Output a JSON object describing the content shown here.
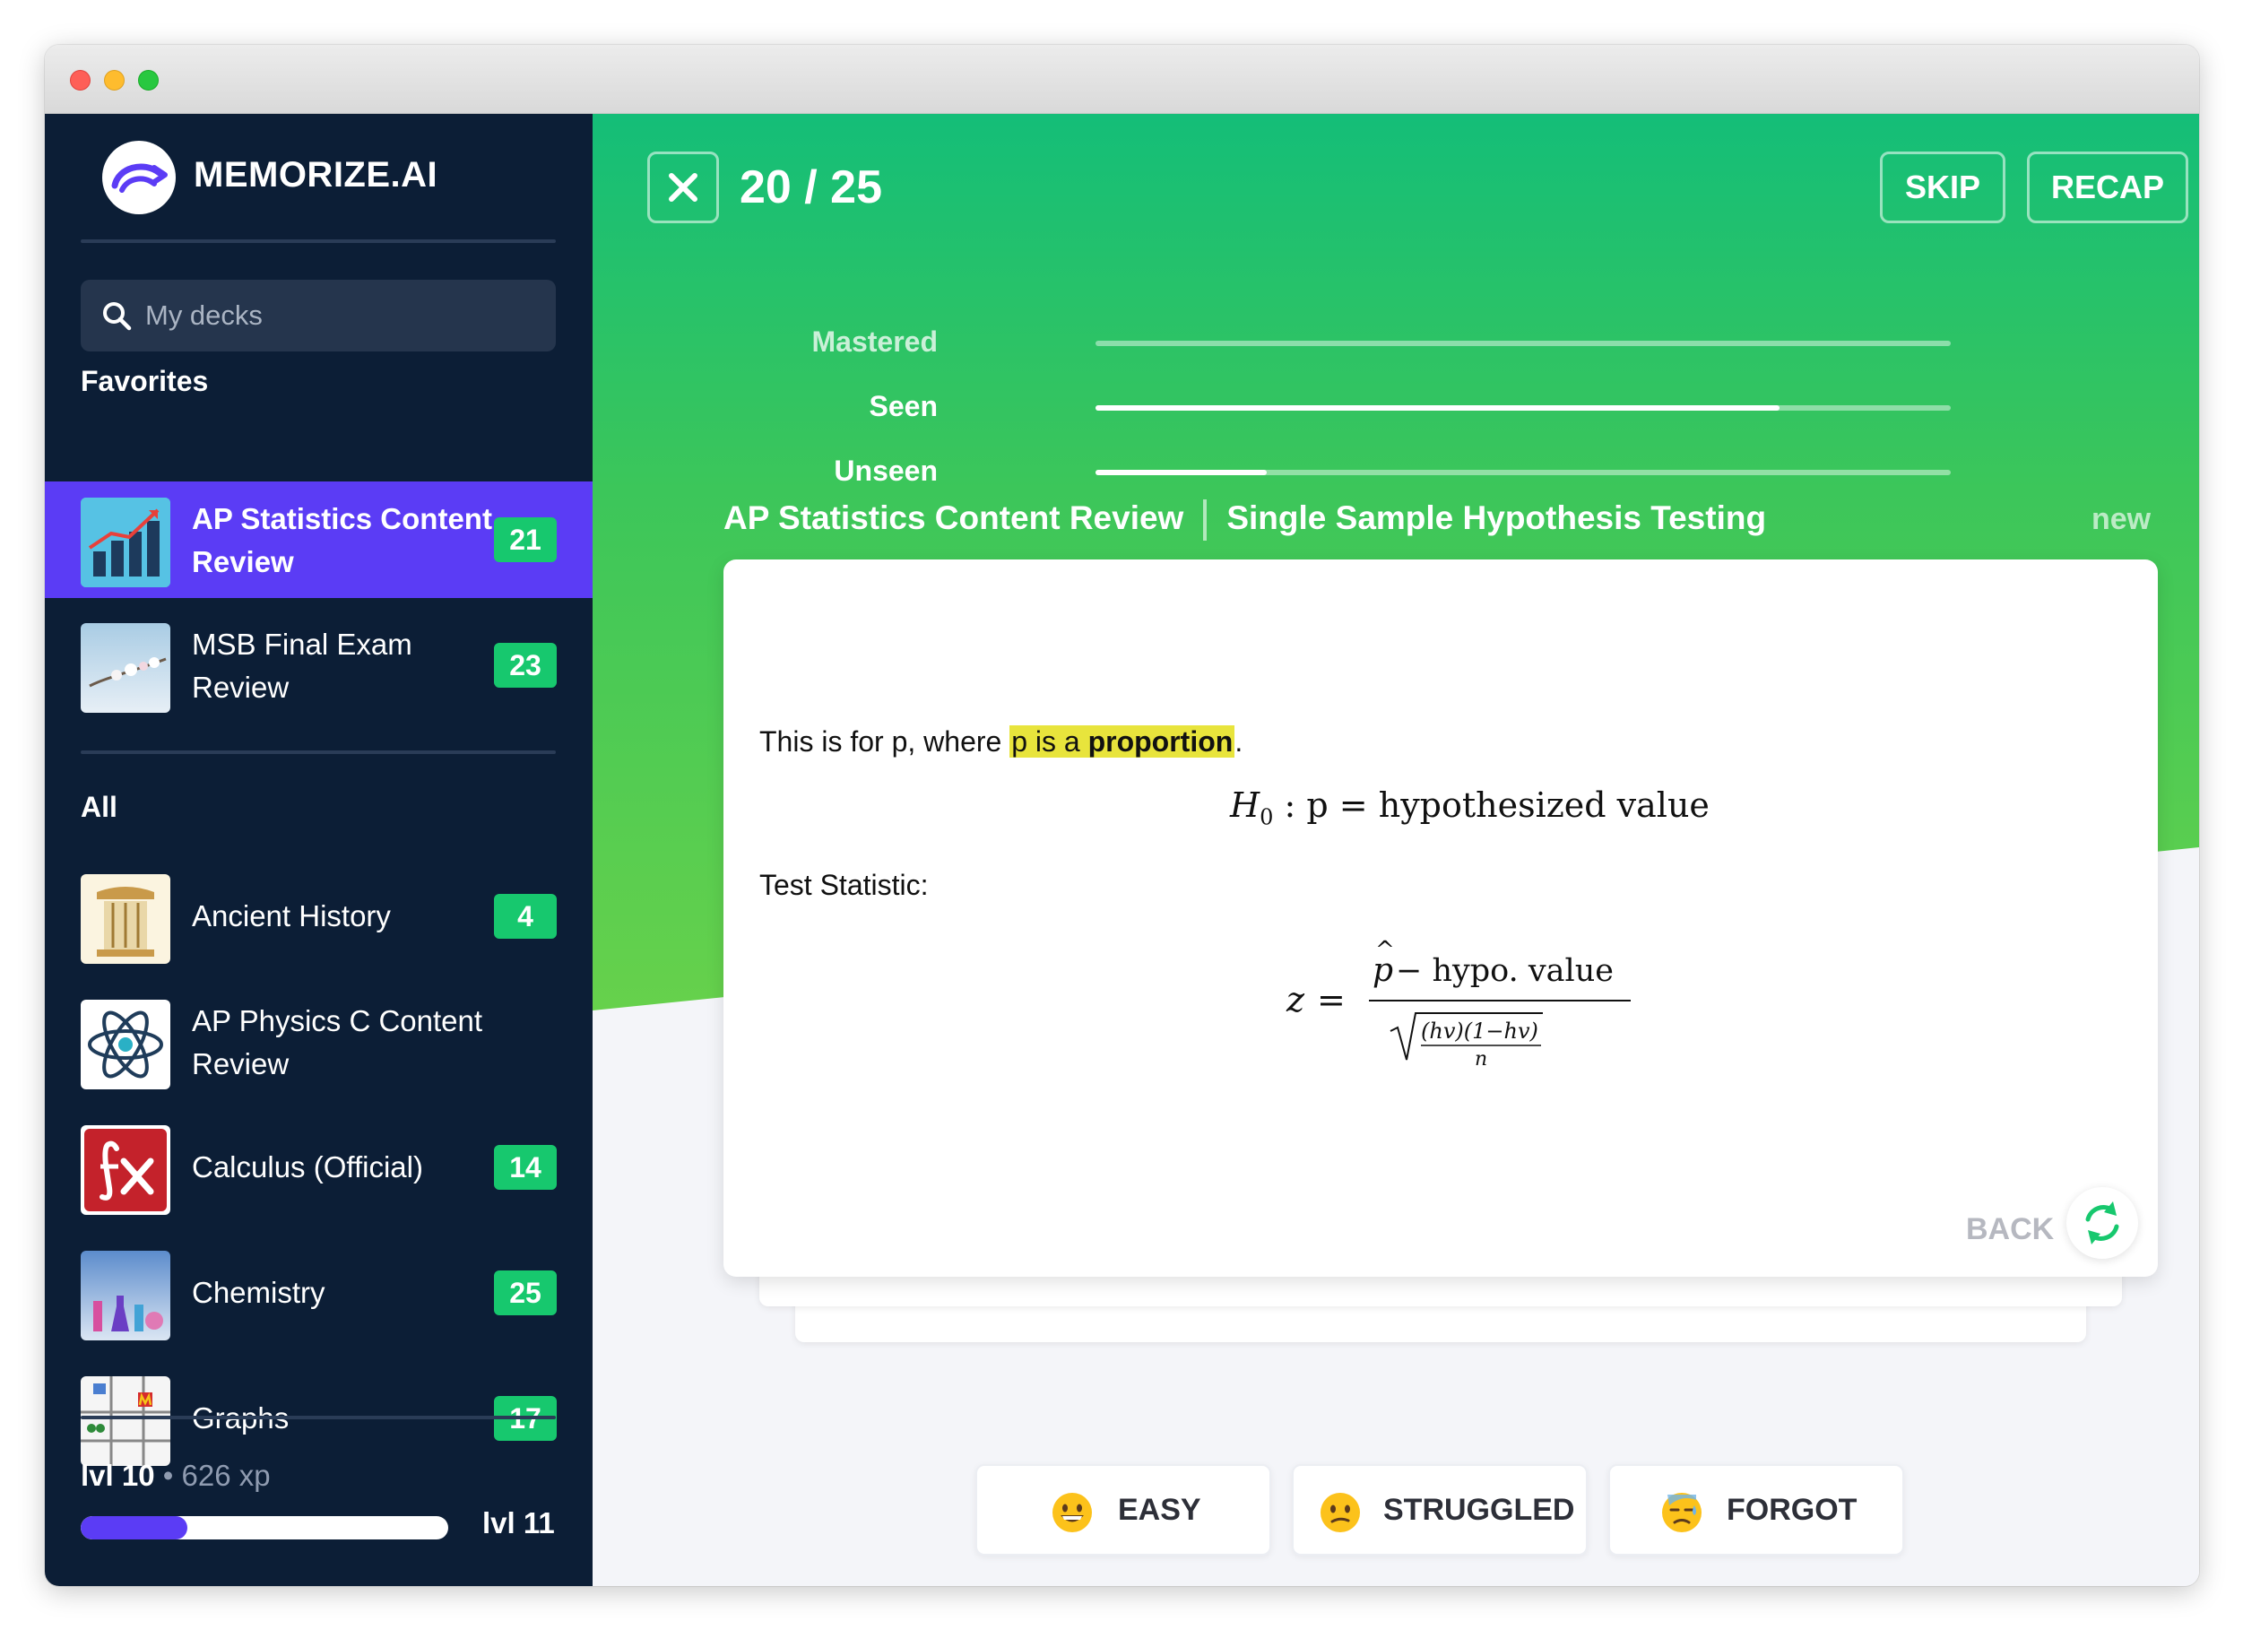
{
  "app": {
    "name": "MEMORIZE.AI"
  },
  "sidebar": {
    "search": {
      "placeholder": "My decks"
    },
    "favorites_label": "Favorites",
    "all_label": "All",
    "favorites": [
      {
        "name": "AP Statistics Content Review",
        "count": "21",
        "icon": "bar-chart-thumbnail",
        "active": true
      },
      {
        "name": "MSB Final Exam Review",
        "count": "23",
        "icon": "blossom-thumbnail",
        "active": false
      }
    ],
    "all": [
      {
        "name": "Ancient History",
        "count": "4",
        "icon": "column-thumbnail"
      },
      {
        "name": "AP Physics C Content Review",
        "count": "",
        "icon": "atom-thumbnail"
      },
      {
        "name": "Calculus (Official)",
        "count": "14",
        "icon": "function-thumbnail"
      },
      {
        "name": "Chemistry",
        "count": "25",
        "icon": "lab-thumbnail"
      },
      {
        "name": "Graphs",
        "count": "17",
        "icon": "map-thumbnail"
      }
    ],
    "level": {
      "current": "lvl 10",
      "separator": "•",
      "xp": "626 xp",
      "next": "lvl 11",
      "progress": 0.29
    }
  },
  "session": {
    "counter": "20 / 25",
    "skip_label": "SKIP",
    "recap_label": "RECAP",
    "progress": [
      {
        "label": "Mastered",
        "value": 0.0
      },
      {
        "label": "Seen",
        "value": 0.8
      },
      {
        "label": "Unseen",
        "value": 0.2
      }
    ],
    "deck_title": "AP Statistics Content Review",
    "topic_title": "Single Sample Hypothesis Testing",
    "status": "new"
  },
  "card": {
    "intro_before": "This is for p, where ",
    "intro_hl_plain": "p is a ",
    "intro_hl_bold": "proportion",
    "intro_after": ".",
    "eq_h0_text": ": p = hypothesized value",
    "test_label": "Test Statistic:",
    "numerator_text": "− hypo. value",
    "radicand_text": "(hv)(1−hv)",
    "back_label": "BACK"
  },
  "answers": [
    {
      "label": "EASY",
      "icon": "grinning-face-icon"
    },
    {
      "label": "STRUGGLED",
      "icon": "confused-face-icon"
    },
    {
      "label": "FORGOT",
      "icon": "sweat-face-icon"
    }
  ],
  "colors": {
    "accent": "#5b3cf5",
    "badge": "#17c86e",
    "sidebar": "#0c1e36",
    "green": "#14be78",
    "highlight": "#e8e43c"
  }
}
